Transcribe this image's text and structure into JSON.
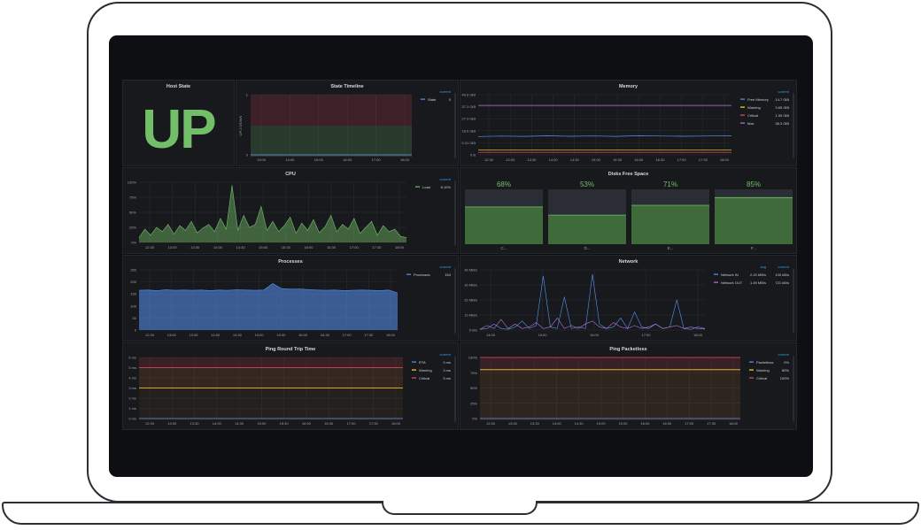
{
  "colors": {
    "green": "#73bf69",
    "orange": "#ff9830",
    "red": "#f2495c",
    "purple": "#b877d9",
    "blue": "#5794f2",
    "yellow": "#fade2a",
    "grid": "#2a2d33",
    "text": "#a0a3a8"
  },
  "time_ticks": [
    "12:30",
    "13:00",
    "13:30",
    "14:00",
    "14:30",
    "15:00",
    "15:30",
    "16:00",
    "16:30",
    "17:00",
    "17:30",
    "18:00"
  ],
  "host_state": {
    "title": "Host State",
    "value": "UP"
  },
  "state_timeline": {
    "title": "State Timeline",
    "ylabel": "UP-0 DOWN",
    "y_ticks": [
      "1",
      "0"
    ],
    "x_ticks": [
      "13:00",
      "14:00",
      "15:00",
      "16:00",
      "17:00",
      "18:00"
    ],
    "legend_header": "current",
    "legend": [
      {
        "name": "State",
        "current": "0",
        "color": "#5794f2"
      }
    ]
  },
  "memory": {
    "title": "Memory",
    "y_ticks": [
      "46.6 GiB",
      "37.3 GiB",
      "27.9 GiB",
      "18.6 GiB",
      "9.31 GiB",
      "0 B"
    ],
    "x_ticks": [
      "12:30",
      "13:00",
      "13:30",
      "14:00",
      "14:30",
      "15:00",
      "15:30",
      "16:00",
      "16:30",
      "17:00",
      "17:30",
      "18:00"
    ],
    "legend_header": "current",
    "legend": [
      {
        "name": "Free Memory",
        "current": "14.7 GiB",
        "color": "#5794f2"
      },
      {
        "name": "Warning",
        "current": "3.65 GiB",
        "color": "#fade2a"
      },
      {
        "name": "Critical",
        "current": "1.99 GiB",
        "color": "#f2495c"
      },
      {
        "name": "Max",
        "current": "38.3 GiB",
        "color": "#b877d9"
      }
    ]
  },
  "cpu": {
    "title": "CPU",
    "y_ticks": [
      "100%",
      "75%",
      "50%",
      "25%",
      "0%"
    ],
    "x_ticks": [
      "12:30",
      "13:00",
      "13:30",
      "14:00",
      "14:30",
      "15:00",
      "15:30",
      "16:00",
      "16:30",
      "17:00",
      "17:30",
      "18:00"
    ],
    "legend_header": "current",
    "legend": [
      {
        "name": "Load",
        "current": "8.10%",
        "color": "#73bf69"
      }
    ]
  },
  "disks": {
    "title": "Disks Free Space",
    "items": [
      {
        "pct": "68%",
        "value": 68,
        "name": "C..."
      },
      {
        "pct": "53%",
        "value": 53,
        "name": "D..."
      },
      {
        "pct": "71%",
        "value": 71,
        "name": "E..."
      },
      {
        "pct": "85%",
        "value": 85,
        "name": "F..."
      }
    ]
  },
  "processes": {
    "title": "Processes",
    "y_ticks": [
      "250",
      "200",
      "150",
      "100",
      "50",
      "0"
    ],
    "x_ticks": [
      "12:30",
      "13:00",
      "13:30",
      "14:00",
      "14:30",
      "15:00",
      "15:30",
      "16:00",
      "16:30",
      "17:00",
      "17:30",
      "18:00"
    ],
    "legend_header": "current",
    "legend": [
      {
        "name": "Processes",
        "current": "154",
        "color": "#5794f2"
      }
    ]
  },
  "network": {
    "title": "Network",
    "y_ticks": [
      "40 MB/s",
      "30 MB/s",
      "20 MB/s",
      "10 MB/s",
      "0 B/s"
    ],
    "x_ticks": [
      "14:00",
      "15:00",
      "16:00",
      "17:00",
      "18:00"
    ],
    "legend_headers": [
      "avg",
      "current"
    ],
    "legend": [
      {
        "name": "Network IN",
        "avg": "2.20 MB/s",
        "current": "100 kB/s",
        "color": "#5794f2"
      },
      {
        "name": "Network OUT",
        "avg": "1.49 MB/s",
        "current": "721 kB/s",
        "color": "#b877d9"
      }
    ]
  },
  "ping_rtt": {
    "title": "Ping Round Trip Time",
    "y_ticks": [
      "6 ms",
      "5 ms",
      "4 ms",
      "3 ms",
      "2 ms",
      "1 ms",
      "0 ms"
    ],
    "x_ticks": [
      "12:30",
      "13:00",
      "13:30",
      "14:00",
      "14:30",
      "15:00",
      "15:30",
      "16:00",
      "16:30",
      "17:00",
      "17:30",
      "18:00"
    ],
    "legend_header": "current",
    "legend": [
      {
        "name": "RTA",
        "current": "0 ms",
        "color": "#5794f2"
      },
      {
        "name": "Warning",
        "current": "3 ms",
        "color": "#fade2a"
      },
      {
        "name": "Critical",
        "current": "5 ms",
        "color": "#f2495c"
      }
    ]
  },
  "ping_loss": {
    "title": "Ping Packetloss",
    "y_ticks": [
      "100%",
      "75%",
      "50%",
      "25%",
      "0%"
    ],
    "x_ticks": [
      "12:30",
      "13:00",
      "13:30",
      "14:00",
      "14:30",
      "15:00",
      "15:30",
      "16:00",
      "16:30",
      "17:00",
      "17:30",
      "18:00"
    ],
    "legend_header": "current",
    "legend": [
      {
        "name": "Packetloss",
        "current": "0%",
        "color": "#5794f2"
      },
      {
        "name": "Warning",
        "current": "80%",
        "color": "#fade2a"
      },
      {
        "name": "Critical",
        "current": "100%",
        "color": "#f2495c"
      }
    ]
  },
  "chart_data": [
    {
      "type": "line",
      "title": "State Timeline",
      "x": [
        "13:00",
        "14:00",
        "15:00",
        "16:00",
        "17:00",
        "18:00"
      ],
      "series": [
        {
          "name": "State",
          "values": [
            0,
            0,
            0,
            0,
            0,
            0
          ]
        }
      ],
      "ylim": [
        0,
        1
      ]
    },
    {
      "type": "line",
      "title": "Memory",
      "series": [
        {
          "name": "Free Memory",
          "values": [
            14.2,
            14.5,
            14.3,
            14.7,
            14.4,
            14.6,
            14.3,
            14.8,
            14.5,
            14.4,
            14.6,
            14.7
          ]
        },
        {
          "name": "Warning",
          "values": [
            3.65,
            3.65,
            3.65,
            3.65,
            3.65,
            3.65,
            3.65,
            3.65,
            3.65,
            3.65,
            3.65,
            3.65
          ]
        },
        {
          "name": "Critical",
          "values": [
            1.99,
            1.99,
            1.99,
            1.99,
            1.99,
            1.99,
            1.99,
            1.99,
            1.99,
            1.99,
            1.99,
            1.99
          ]
        },
        {
          "name": "Max",
          "values": [
            38.3,
            38.3,
            38.3,
            38.3,
            38.3,
            38.3,
            38.3,
            38.3,
            38.3,
            38.3,
            38.3,
            38.3
          ]
        }
      ],
      "ylim": [
        0,
        46.6
      ]
    },
    {
      "type": "area",
      "title": "CPU",
      "series": [
        {
          "name": "Load",
          "values": [
            8,
            22,
            12,
            25,
            18,
            30,
            14,
            28,
            20,
            35,
            16,
            24,
            30,
            18,
            40,
            22,
            95,
            20,
            45,
            25,
            30,
            60,
            20,
            35,
            18,
            28,
            42,
            15,
            32,
            20,
            38,
            16,
            26,
            45,
            18,
            30,
            22,
            40,
            15,
            25,
            35,
            12,
            28,
            18,
            22,
            10,
            8
          ]
        }
      ],
      "ylim": [
        0,
        100
      ]
    },
    {
      "type": "bar",
      "title": "Disks Free Space",
      "categories": [
        "C...",
        "D...",
        "E...",
        "F..."
      ],
      "values": [
        68,
        53,
        71,
        85
      ],
      "ylim": [
        0,
        100
      ]
    },
    {
      "type": "area",
      "title": "Processes",
      "series": [
        {
          "name": "Processes",
          "values": [
            165,
            166,
            164,
            167,
            165,
            166,
            165,
            166,
            164,
            166,
            165,
            167,
            166,
            165,
            166,
            193,
            172,
            170,
            171,
            168,
            166,
            165,
            166,
            164,
            165,
            166,
            165,
            164,
            166,
            154
          ]
        }
      ],
      "ylim": [
        0,
        250
      ]
    },
    {
      "type": "line",
      "title": "Network",
      "series": [
        {
          "name": "Network IN",
          "values": [
            0.5,
            1,
            4,
            1,
            0.5,
            2,
            6,
            1,
            3,
            36,
            2,
            1,
            22,
            1,
            2,
            1,
            37,
            4,
            1,
            2,
            8,
            1,
            12,
            2,
            1,
            4,
            1,
            2,
            20,
            1,
            0.5,
            2,
            1
          ]
        },
        {
          "name": "Network OUT",
          "values": [
            0.5,
            3,
            1,
            7,
            1,
            4,
            1,
            2,
            5,
            1,
            2,
            8,
            1,
            3,
            1,
            4,
            6,
            2,
            1,
            5,
            2,
            1,
            3,
            1,
            2,
            4,
            1,
            2,
            3,
            1,
            2,
            1,
            0.7
          ]
        }
      ],
      "ylim": [
        0,
        40
      ]
    },
    {
      "type": "line",
      "title": "Ping Round Trip Time",
      "series": [
        {
          "name": "RTA",
          "values": [
            0,
            0,
            0,
            0,
            0,
            0,
            0,
            0,
            0,
            0,
            0,
            0
          ]
        },
        {
          "name": "Warning",
          "values": [
            3,
            3,
            3,
            3,
            3,
            3,
            3,
            3,
            3,
            3,
            3,
            3
          ]
        },
        {
          "name": "Critical",
          "values": [
            5,
            5,
            5,
            5,
            5,
            5,
            5,
            5,
            5,
            5,
            5,
            5
          ]
        }
      ],
      "ylim": [
        0,
        6
      ]
    },
    {
      "type": "line",
      "title": "Ping Packetloss",
      "series": [
        {
          "name": "Packetloss",
          "values": [
            0,
            0,
            0,
            0,
            0,
            0,
            0,
            0,
            0,
            0,
            0,
            0
          ]
        },
        {
          "name": "Warning",
          "values": [
            80,
            80,
            80,
            80,
            80,
            80,
            80,
            80,
            80,
            80,
            80,
            80
          ]
        },
        {
          "name": "Critical",
          "values": [
            100,
            100,
            100,
            100,
            100,
            100,
            100,
            100,
            100,
            100,
            100,
            100
          ]
        }
      ],
      "ylim": [
        0,
        100
      ]
    }
  ]
}
